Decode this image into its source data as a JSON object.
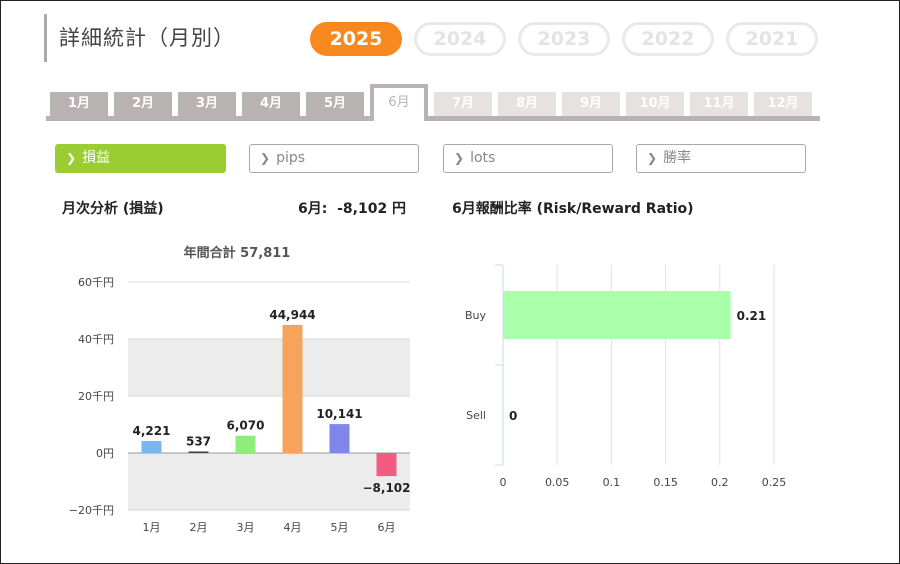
{
  "page": {
    "title": "詳細統計（月別）"
  },
  "years": [
    {
      "label": "2025",
      "active": true
    },
    {
      "label": "2024",
      "active": false
    },
    {
      "label": "2023",
      "active": false
    },
    {
      "label": "2022",
      "active": false
    },
    {
      "label": "2021",
      "active": false
    }
  ],
  "months": [
    {
      "label": "1月",
      "state": "past"
    },
    {
      "label": "2月",
      "state": "past"
    },
    {
      "label": "3月",
      "state": "past"
    },
    {
      "label": "4月",
      "state": "past"
    },
    {
      "label": "5月",
      "state": "past"
    },
    {
      "label": "6月",
      "state": "active"
    },
    {
      "label": "7月",
      "state": "future"
    },
    {
      "label": "8月",
      "state": "future"
    },
    {
      "label": "9月",
      "state": "future"
    },
    {
      "label": "10月",
      "state": "future"
    },
    {
      "label": "11月",
      "state": "future"
    },
    {
      "label": "12月",
      "state": "future"
    }
  ],
  "metrics": [
    {
      "label": "損益",
      "active": true
    },
    {
      "label": "pips",
      "active": false
    },
    {
      "label": "lots",
      "active": false
    },
    {
      "label": "勝率",
      "active": false
    }
  ],
  "icons": {
    "chevron": "chevron-right-icon"
  },
  "colors": {
    "accent_orange": "#f7891f",
    "active_green": "#9acd32",
    "tab_gray": "#b9b2b2"
  },
  "sections": {
    "monthly_title": "月次分析 (損益)",
    "monthly_value": "6月:  -8,102 円",
    "rr_title": "6月報酬比率 (Risk/Reward Ratio)"
  },
  "chart_data": [
    {
      "type": "bar",
      "title": "年間合計 57,811",
      "categories": [
        "1月",
        "2月",
        "3月",
        "4月",
        "5月",
        "6月"
      ],
      "values": [
        4221,
        537,
        6070,
        44944,
        10141,
        -8102
      ],
      "value_labels": [
        "4,221",
        "537",
        "6,070",
        "44,944",
        "10,141",
        "−8,102"
      ],
      "colors": [
        "#7cb5ec",
        "#434348",
        "#90ed7d",
        "#f7a35c",
        "#8085e9",
        "#f15c80"
      ],
      "yticks": [
        60000,
        40000,
        20000,
        0,
        -20000
      ],
      "ytick_labels": [
        "60千円",
        "40千円",
        "20千円",
        "0円",
        "−20千円"
      ],
      "ylim": [
        -20000,
        60000
      ],
      "grid": true
    },
    {
      "type": "bar",
      "orientation": "horizontal",
      "categories": [
        "Buy",
        "Sell"
      ],
      "values": [
        0.21,
        0
      ],
      "value_labels": [
        "0.21",
        "0"
      ],
      "color": "#aaffaa",
      "xticks": [
        0,
        0.05,
        0.1,
        0.15,
        0.2,
        0.25
      ],
      "xtick_labels": [
        "0",
        "0.05",
        "0.1",
        "0.15",
        "0.2",
        "0.25"
      ],
      "xlim": [
        0,
        0.25
      ],
      "grid": true
    }
  ]
}
